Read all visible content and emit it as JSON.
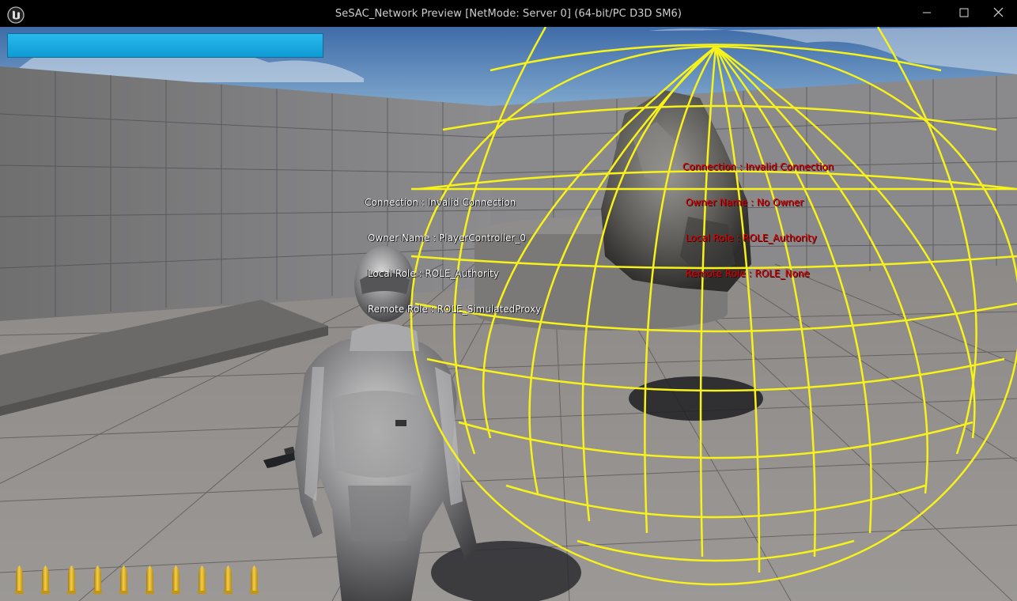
{
  "window": {
    "title": "SeSAC_Network Preview [NetMode: Server 0]  (64-bit/PC D3D SM6)",
    "buttons": [
      "minimize",
      "maximize",
      "close"
    ]
  },
  "hud": {
    "health_percent": 100,
    "health_color": "#1aa7de",
    "ammo_count": 10,
    "ammo_color": "#e7b21f"
  },
  "debug": {
    "player": {
      "connection": "Connection : Invalid Connection",
      "owner": " Owner Name : PlayerController_0",
      "local_role": " Local Role : ROLE_Authority",
      "remote_role": " Remote Role : ROLE_SimulatedProxy"
    },
    "rock": {
      "connection": "Connection : Invalid Connection",
      "owner": " Owner Name : No Owner",
      "local_role": " Local Role : ROLE_Authority",
      "remote_role": " Remote Role : ROLE_None"
    }
  },
  "colors": {
    "debug_sphere": "#f7f21a",
    "rock_text": "#d80000",
    "player_text": "#ffffff"
  }
}
